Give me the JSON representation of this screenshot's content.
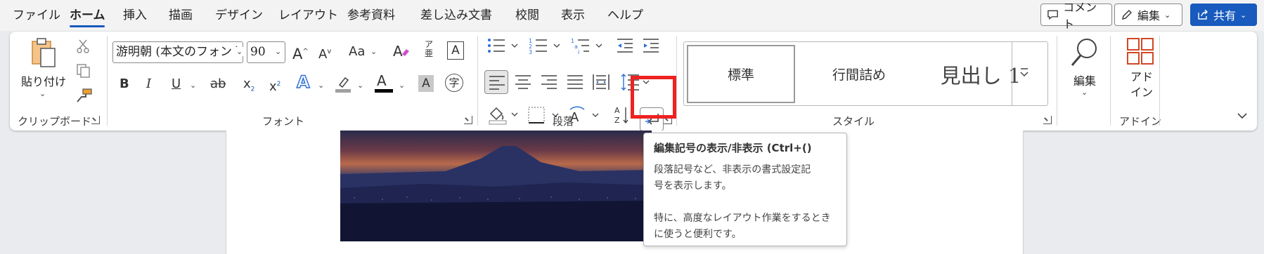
{
  "tabs": {
    "file": "ファイル",
    "home": "ホーム",
    "insert": "挿入",
    "draw": "描画",
    "design": "デザイン",
    "layout": "レイアウト",
    "references": "参考資料",
    "mailings": "差し込み文書",
    "review": "校閲",
    "view": "表示",
    "help": "ヘルプ"
  },
  "top_buttons": {
    "comment": "コメント",
    "editing": "編集",
    "share": "共有"
  },
  "clipboard": {
    "paste": "貼り付け",
    "group": "クリップボード"
  },
  "font": {
    "name": "游明朝 (本文のフォント",
    "size": "90",
    "group": "フォント",
    "change_case": "Aa",
    "grow": "A",
    "shrink": "A",
    "bold": "B",
    "italic": "I",
    "underline": "U",
    "strike": "ab",
    "subscript": "x",
    "superscript": "x",
    "effects": "A",
    "font_color": "A",
    "shading": "A",
    "enclose": "字",
    "phonetic": "亜",
    "border_char": "A"
  },
  "paragraph": {
    "group": "段落"
  },
  "styles": {
    "group": "スタイル",
    "items": [
      "標準",
      "行間詰め",
      "見出し 1"
    ]
  },
  "editing_group": {
    "label": "編集"
  },
  "addins": {
    "label_line1": "アド",
    "label_line2": "イン",
    "group": "アドイン"
  },
  "tooltip": {
    "title": "編集記号の表示/非表示 (Ctrl+()",
    "body1_line1": "段落記号など、非表示の書式設定記",
    "body1_line2": "号を表示します。",
    "body2_line1": "特に、高度なレイアウト作業をするとき",
    "body2_line2": "に使うと便利です。"
  },
  "colors": {
    "accent": "#185abd",
    "highlight": "#e22222",
    "font_color_bar": "#000000",
    "highlighter_bar": "#a0a0a0"
  }
}
